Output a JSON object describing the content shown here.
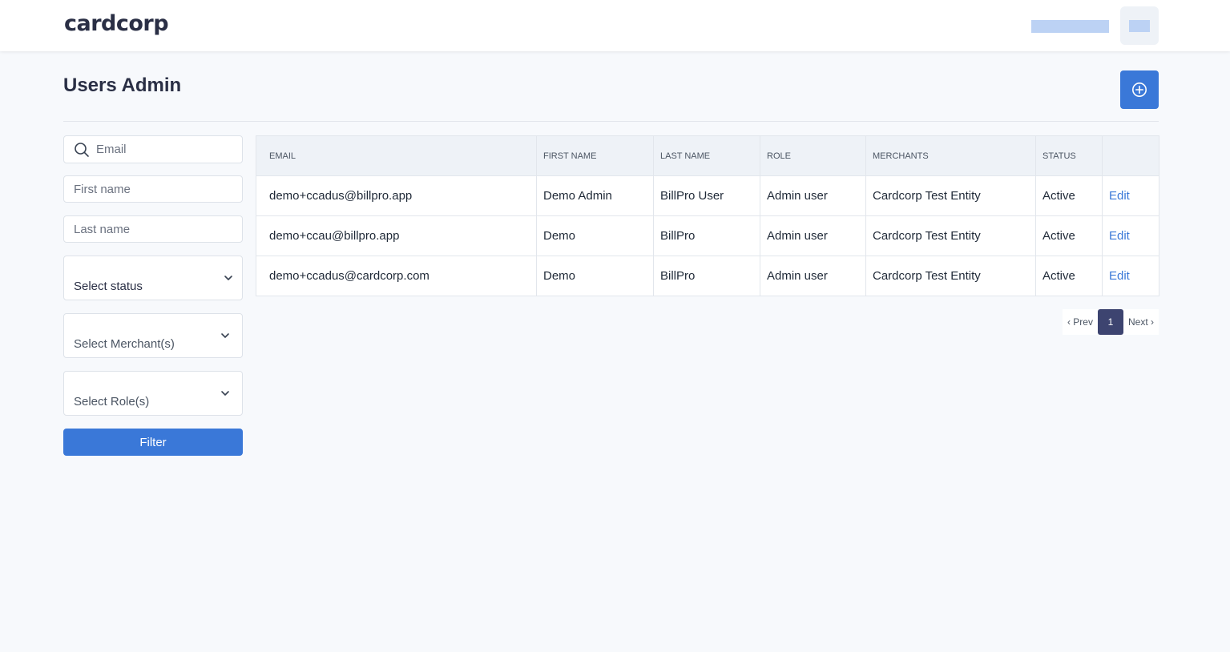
{
  "header": {
    "logo_text": "cardcorp"
  },
  "page": {
    "title": "Users Admin"
  },
  "filters": {
    "email_placeholder": "Email",
    "first_name_placeholder": "First name",
    "last_name_placeholder": "Last name",
    "status_label": "Select status",
    "merchant_label": "Select Merchant(s)",
    "role_label": "Select Role(s)",
    "filter_label": "Filter"
  },
  "table": {
    "columns": [
      "EMAIL",
      "FIRST NAME",
      "LAST NAME",
      "ROLE",
      "MERCHANTS",
      "STATUS",
      ""
    ],
    "rows": [
      {
        "email": "demo+ccadus@billpro.app",
        "first_name": "Demo Admin",
        "last_name": "BillPro User",
        "role": "Admin user",
        "merchants": "Cardcorp Test Entity",
        "status": "Active",
        "action": "Edit"
      },
      {
        "email": "demo+ccau@billpro.app",
        "first_name": "Demo",
        "last_name": "BillPro",
        "role": "Admin user",
        "merchants": "Cardcorp Test Entity",
        "status": "Active",
        "action": "Edit"
      },
      {
        "email": "demo+ccadus@cardcorp.com",
        "first_name": "Demo",
        "last_name": "BillPro",
        "role": "Admin user",
        "merchants": "Cardcorp Test Entity",
        "status": "Active",
        "action": "Edit"
      }
    ]
  },
  "pagination": {
    "prev_label": "‹ Prev",
    "current_page": "1",
    "next_label": "Next ›"
  },
  "colors": {
    "accent": "#3a78d8",
    "page_active": "#3d4470",
    "brand_text": "#2a2f45",
    "placeholder_bar": "#bcd2f4"
  }
}
